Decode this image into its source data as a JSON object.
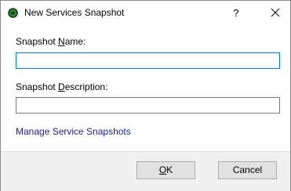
{
  "window": {
    "title": "New Services Snapshot",
    "help_label": "?",
    "app_icon": "app-icon",
    "close_icon": "close-icon"
  },
  "form": {
    "name_label_pre": "Snapshot ",
    "name_label_mnemonic": "N",
    "name_label_post": "ame:",
    "name_value": "",
    "description_label_pre": "Snapshot ",
    "description_label_mnemonic": "D",
    "description_label_post": "escription:",
    "description_value": ""
  },
  "link": {
    "manage_label": "Manage Service Snapshots"
  },
  "buttons": {
    "ok_mnemonic": "O",
    "ok_rest": "K",
    "cancel_label": "Cancel"
  },
  "colors": {
    "accent": "#0078d7",
    "link": "#1a1aa6",
    "footer_bg": "#f0f0f0"
  }
}
